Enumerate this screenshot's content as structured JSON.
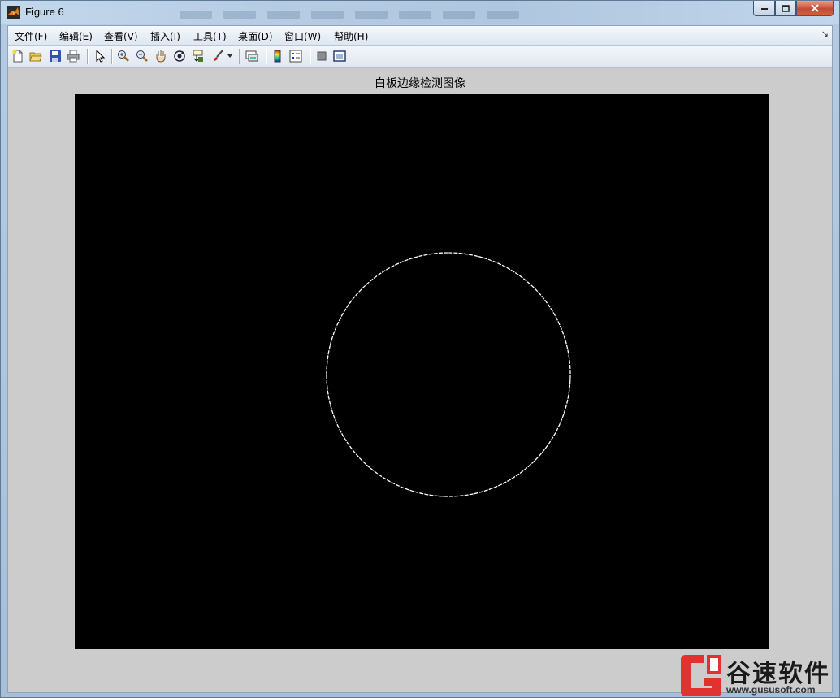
{
  "window": {
    "title": "Figure 6"
  },
  "menubar": {
    "items": [
      {
        "label": "文件(F)"
      },
      {
        "label": "编辑(E)"
      },
      {
        "label": "查看(V)"
      },
      {
        "label": "插入(I)"
      },
      {
        "label": "工具(T)"
      },
      {
        "label": "桌面(D)"
      },
      {
        "label": "窗口(W)"
      },
      {
        "label": "帮助(H)"
      }
    ],
    "dock_glyph": "↘"
  },
  "toolbar": {
    "icons": [
      "new-figure-icon",
      "open-file-icon",
      "save-icon",
      "print-icon",
      "edit-plot-icon",
      "zoom-in-icon",
      "zoom-out-icon",
      "pan-icon",
      "rotate-3d-icon",
      "data-cursor-icon",
      "brush-icon",
      "brush-dropdown-icon",
      "link-plot-icon",
      "insert-colorbar-icon",
      "insert-legend-icon",
      "hide-plot-tools-icon",
      "show-plot-tools-icon"
    ]
  },
  "figure": {
    "axes_title": "白板边缘检测图像",
    "background_color": "#000000",
    "edge_color": "#ffffff",
    "figure_color": "#cccccc"
  },
  "watermark": {
    "text": "谷速软件",
    "url": "www.gususoft.com",
    "logo_color": "#e2322f"
  }
}
